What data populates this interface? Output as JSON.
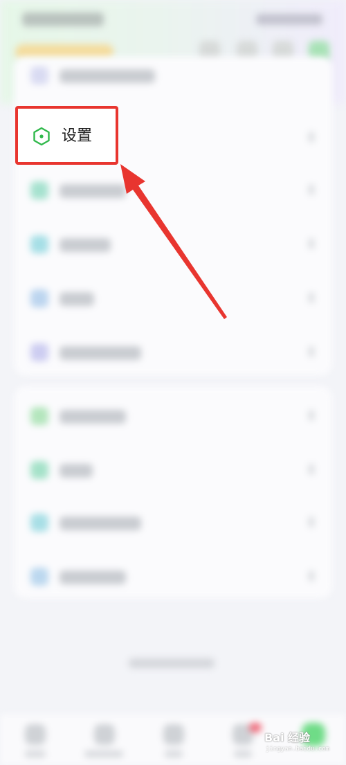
{
  "settings": {
    "label": "设置"
  },
  "colors": {
    "highlight_border": "#e8352f",
    "arrow": "#e8352f",
    "settings_icon": "#2fb84a"
  },
  "icons": {
    "settings": "hexagon-settings-icon",
    "annotation": "red-arrow-annotation"
  },
  "watermark": {
    "brand": "Bai 经验",
    "url": "jingyan.baidu.com"
  }
}
